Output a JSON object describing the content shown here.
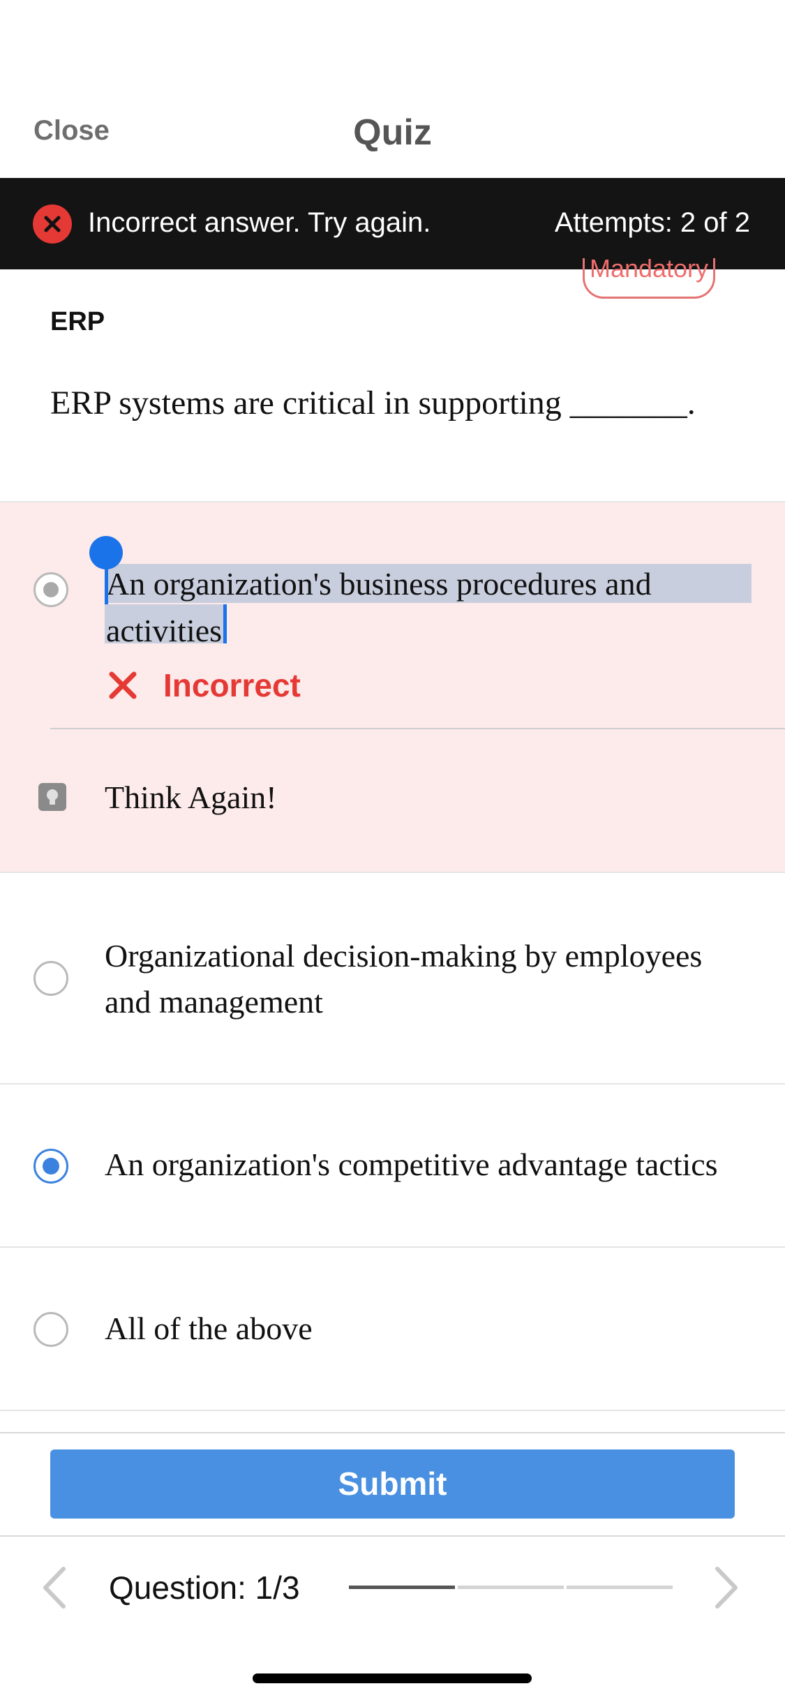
{
  "header": {
    "close_label": "Close",
    "title": "Quiz"
  },
  "banner": {
    "message": "Incorrect answer. Try again.",
    "attempts": "Attempts: 2 of 2"
  },
  "badge": "Mandatory",
  "question": {
    "section": "ERP",
    "text": "ERP systems are critical in supporting _______."
  },
  "options": [
    {
      "line1": "An organization's business procedures and",
      "line2": "activities",
      "feedback": "Incorrect",
      "hint": "Think Again!"
    },
    {
      "line1": "Organizational decision-making by employees",
      "line2": "and management"
    },
    {
      "line1": "An organization's competitive advantage tactics"
    },
    {
      "line1": "All of the above"
    }
  ],
  "footer": {
    "submit_label": "Submit",
    "question_counter": "Question: 1/3",
    "progress_segments_completed": 1,
    "progress_segments_total": 3
  },
  "colors": {
    "error": "#e53935",
    "accent": "#4a90e2",
    "wrong_bg": "#fdeaea"
  }
}
